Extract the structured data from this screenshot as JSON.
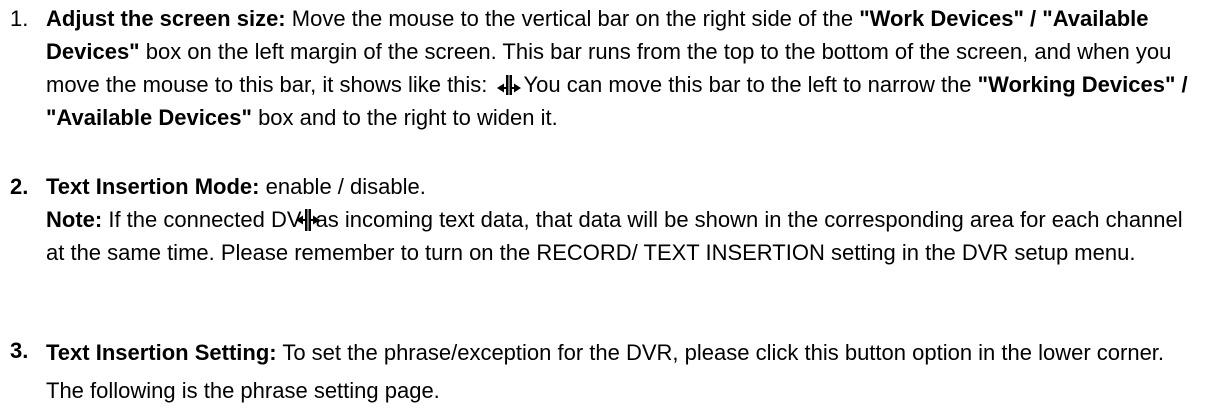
{
  "items": [
    {
      "number": "1.",
      "title": "Adjust the screen size:",
      "p1": " Move the mouse to the vertical bar on the right side of the ",
      "b1": "\"Work Devices\" / \"Available Devices\"",
      "p2": " box on the left margin of the screen. This bar runs from the top to the bottom of the screen, and when you move the mouse to this bar, it shows like this: ",
      "p3": "You can move this bar to the left to narrow the ",
      "b2": "\"Working Devices\" / \"Available Devices\"",
      "p4": " box and to the right to widen it."
    },
    {
      "number": "2.",
      "title": "Text Insertion Mode:",
      "desc": " enable / disable.",
      "note_label": "Note:",
      "note_a": " If the connected DV",
      "note_b": "as incoming text data, that data will be shown in the corresponding area for each channel at the same time. Please remember to turn on the RECORD/ TEXT INSERTION setting in the DVR setup menu."
    },
    {
      "number": "3.",
      "title": "Text Insertion Setting:",
      "desc": " To set the phrase/exception for the DVR, please click this button option in the lower corner. The following is the phrase setting page."
    }
  ],
  "icons": {
    "cursor": "resize-horizontal-cursor-icon"
  },
  "colors": {
    "text": "#000000",
    "background": "#ffffff"
  }
}
